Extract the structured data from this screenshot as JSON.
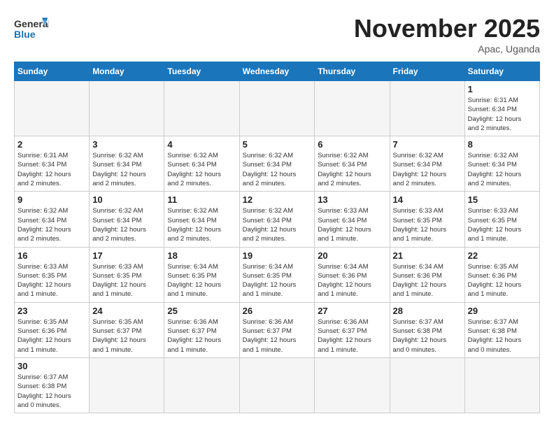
{
  "header": {
    "logo_general": "General",
    "logo_blue": "Blue",
    "month_title": "November 2025",
    "location": "Apac, Uganda"
  },
  "weekdays": [
    "Sunday",
    "Monday",
    "Tuesday",
    "Wednesday",
    "Thursday",
    "Friday",
    "Saturday"
  ],
  "days": {
    "d1": {
      "num": "1",
      "info": "Sunrise: 6:31 AM\nSunset: 6:34 PM\nDaylight: 12 hours\nand 2 minutes."
    },
    "d2": {
      "num": "2",
      "info": "Sunrise: 6:31 AM\nSunset: 6:34 PM\nDaylight: 12 hours\nand 2 minutes."
    },
    "d3": {
      "num": "3",
      "info": "Sunrise: 6:32 AM\nSunset: 6:34 PM\nDaylight: 12 hours\nand 2 minutes."
    },
    "d4": {
      "num": "4",
      "info": "Sunrise: 6:32 AM\nSunset: 6:34 PM\nDaylight: 12 hours\nand 2 minutes."
    },
    "d5": {
      "num": "5",
      "info": "Sunrise: 6:32 AM\nSunset: 6:34 PM\nDaylight: 12 hours\nand 2 minutes."
    },
    "d6": {
      "num": "6",
      "info": "Sunrise: 6:32 AM\nSunset: 6:34 PM\nDaylight: 12 hours\nand 2 minutes."
    },
    "d7": {
      "num": "7",
      "info": "Sunrise: 6:32 AM\nSunset: 6:34 PM\nDaylight: 12 hours\nand 2 minutes."
    },
    "d8": {
      "num": "8",
      "info": "Sunrise: 6:32 AM\nSunset: 6:34 PM\nDaylight: 12 hours\nand 2 minutes."
    },
    "d9": {
      "num": "9",
      "info": "Sunrise: 6:32 AM\nSunset: 6:34 PM\nDaylight: 12 hours\nand 2 minutes."
    },
    "d10": {
      "num": "10",
      "info": "Sunrise: 6:32 AM\nSunset: 6:34 PM\nDaylight: 12 hours\nand 2 minutes."
    },
    "d11": {
      "num": "11",
      "info": "Sunrise: 6:32 AM\nSunset: 6:34 PM\nDaylight: 12 hours\nand 2 minutes."
    },
    "d12": {
      "num": "12",
      "info": "Sunrise: 6:32 AM\nSunset: 6:34 PM\nDaylight: 12 hours\nand 2 minutes."
    },
    "d13": {
      "num": "13",
      "info": "Sunrise: 6:33 AM\nSunset: 6:34 PM\nDaylight: 12 hours\nand 1 minute."
    },
    "d14": {
      "num": "14",
      "info": "Sunrise: 6:33 AM\nSunset: 6:35 PM\nDaylight: 12 hours\nand 1 minute."
    },
    "d15": {
      "num": "15",
      "info": "Sunrise: 6:33 AM\nSunset: 6:35 PM\nDaylight: 12 hours\nand 1 minute."
    },
    "d16": {
      "num": "16",
      "info": "Sunrise: 6:33 AM\nSunset: 6:35 PM\nDaylight: 12 hours\nand 1 minute."
    },
    "d17": {
      "num": "17",
      "info": "Sunrise: 6:33 AM\nSunset: 6:35 PM\nDaylight: 12 hours\nand 1 minute."
    },
    "d18": {
      "num": "18",
      "info": "Sunrise: 6:34 AM\nSunset: 6:35 PM\nDaylight: 12 hours\nand 1 minute."
    },
    "d19": {
      "num": "19",
      "info": "Sunrise: 6:34 AM\nSunset: 6:35 PM\nDaylight: 12 hours\nand 1 minute."
    },
    "d20": {
      "num": "20",
      "info": "Sunrise: 6:34 AM\nSunset: 6:36 PM\nDaylight: 12 hours\nand 1 minute."
    },
    "d21": {
      "num": "21",
      "info": "Sunrise: 6:34 AM\nSunset: 6:36 PM\nDaylight: 12 hours\nand 1 minute."
    },
    "d22": {
      "num": "22",
      "info": "Sunrise: 6:35 AM\nSunset: 6:36 PM\nDaylight: 12 hours\nand 1 minute."
    },
    "d23": {
      "num": "23",
      "info": "Sunrise: 6:35 AM\nSunset: 6:36 PM\nDaylight: 12 hours\nand 1 minute."
    },
    "d24": {
      "num": "24",
      "info": "Sunrise: 6:35 AM\nSunset: 6:37 PM\nDaylight: 12 hours\nand 1 minute."
    },
    "d25": {
      "num": "25",
      "info": "Sunrise: 6:36 AM\nSunset: 6:37 PM\nDaylight: 12 hours\nand 1 minute."
    },
    "d26": {
      "num": "26",
      "info": "Sunrise: 6:36 AM\nSunset: 6:37 PM\nDaylight: 12 hours\nand 1 minute."
    },
    "d27": {
      "num": "27",
      "info": "Sunrise: 6:36 AM\nSunset: 6:37 PM\nDaylight: 12 hours\nand 1 minute."
    },
    "d28": {
      "num": "28",
      "info": "Sunrise: 6:37 AM\nSunset: 6:38 PM\nDaylight: 12 hours\nand 0 minutes."
    },
    "d29": {
      "num": "29",
      "info": "Sunrise: 6:37 AM\nSunset: 6:38 PM\nDaylight: 12 hours\nand 0 minutes."
    },
    "d30": {
      "num": "30",
      "info": "Sunrise: 6:37 AM\nSunset: 6:38 PM\nDaylight: 12 hours\nand 0 minutes."
    }
  }
}
